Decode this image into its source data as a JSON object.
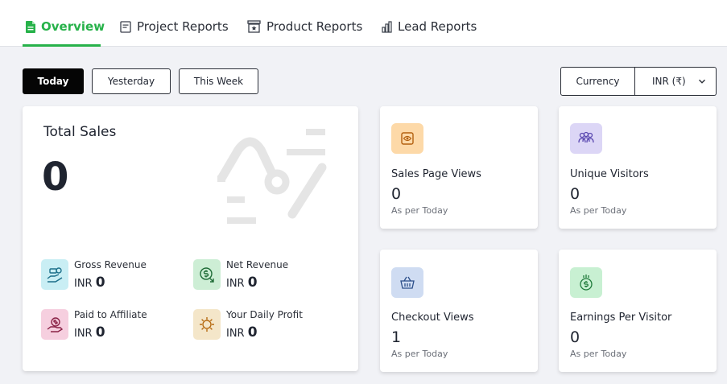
{
  "tabs": [
    {
      "label": "Overview",
      "icon": "document-icon",
      "active": true
    },
    {
      "label": "Project Reports",
      "icon": "report-icon",
      "active": false
    },
    {
      "label": "Product Reports",
      "icon": "store-icon",
      "active": false
    },
    {
      "label": "Lead Reports",
      "icon": "bar-chart-icon",
      "active": false
    }
  ],
  "filters": {
    "today": "Today",
    "yesterday": "Yesterday",
    "this_week": "This Week"
  },
  "currency": {
    "label": "Currency",
    "selected": "INR (₹)"
  },
  "total_sales": {
    "title": "Total Sales",
    "value": "0",
    "items": [
      {
        "label": "Gross Revenue",
        "currency": "INR",
        "value": "0",
        "icon": "hand-money-icon",
        "bg": "#c9eef4"
      },
      {
        "label": "Net Revenue",
        "currency": "INR",
        "value": "0",
        "icon": "dollar-refresh-icon",
        "bg": "#cdeed5"
      },
      {
        "label": "Paid to Affiliate",
        "currency": "INR",
        "value": "0",
        "icon": "hand-dollar-icon",
        "bg": "#f6cfdf"
      },
      {
        "label": "Your Daily Profit",
        "currency": "INR",
        "value": "0",
        "icon": "sun-icon",
        "bg": "#f4e6c9"
      }
    ]
  },
  "stats": [
    {
      "label": "Sales Page Views",
      "value": "0",
      "sub": "As per Today",
      "icon": "eye-icon",
      "bg": "#fdd9a8"
    },
    {
      "label": "Unique Visitors",
      "value": "0",
      "sub": "As per Today",
      "icon": "users-icon",
      "bg": "#dcd6f6"
    },
    {
      "label": "Checkout Views",
      "value": "1",
      "sub": "As per Today",
      "icon": "basket-icon",
      "bg": "#cfdcf2"
    },
    {
      "label": "Earnings Per Visitor",
      "value": "0",
      "sub": "As per Today",
      "icon": "money-bag-icon",
      "bg": "#c8f0d2"
    }
  ],
  "colors": {
    "accent": "#27b24a",
    "background": "#f1f2f6",
    "dark_button": "#050505"
  }
}
